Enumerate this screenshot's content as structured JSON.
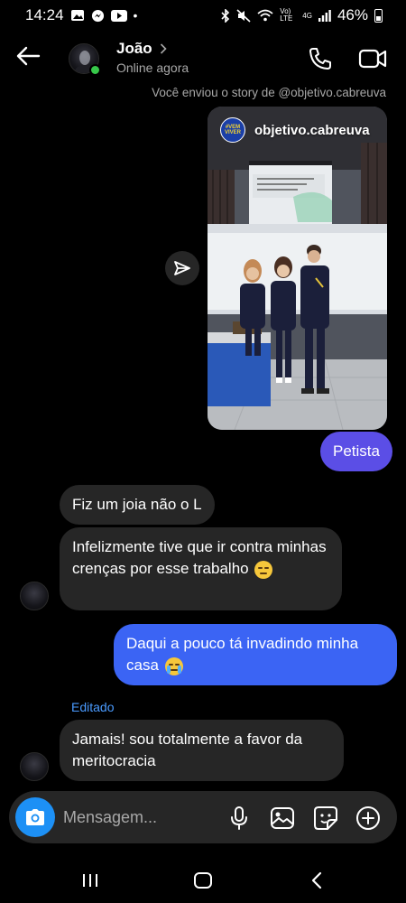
{
  "status": {
    "time": "14:24",
    "network": "Vo) LTE",
    "signal_type": "4G",
    "battery": "46%"
  },
  "header": {
    "contact_name": "João",
    "status_text": "Online agora"
  },
  "story": {
    "caption": "Você enviou o story de @objetivo.cabreuva",
    "username": "objetivo.cabreuva",
    "logo_text": "#VEM VIVER"
  },
  "messages": {
    "m1": "Petista",
    "m2": "Fiz um joia não o L",
    "m3": "Infelizmente tive que ir contra minhas crenças por esse trabalho",
    "m4": "Daqui a pouco tá invadindo minha casa",
    "edited_label": "Editado",
    "m5": "Jamais! sou totalmente a favor da meritocracia"
  },
  "composer": {
    "placeholder": "Mensagem..."
  },
  "colors": {
    "outgoing": "#3b64f4",
    "outgoing_first": "#5b4ee6",
    "incoming": "#262626",
    "accent": "#1d90f5",
    "online": "#37c84a"
  }
}
